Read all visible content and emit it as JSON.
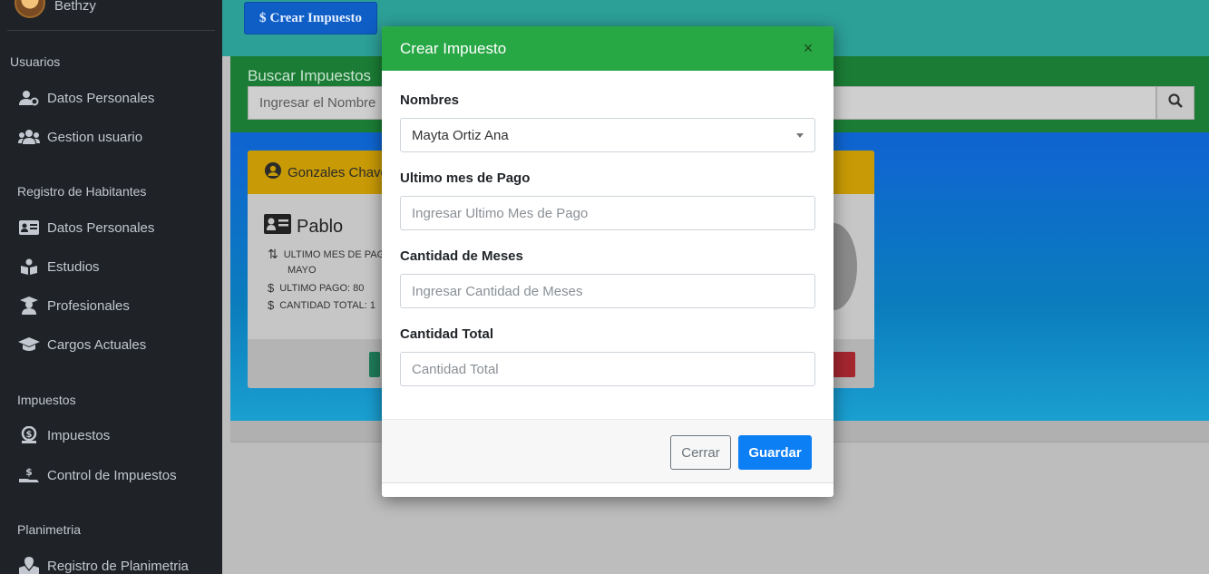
{
  "sidebar": {
    "user_name": "Bethzy",
    "sections": {
      "usuarios": "Usuarios",
      "registro": "Registro de Habitantes",
      "impuestos": "Impuestos",
      "planimetria": "Planimetria"
    },
    "items": [
      {
        "label": "Datos Personales",
        "icon": "user-cog-icon"
      },
      {
        "label": "Gestion usuario",
        "icon": "users-icon"
      },
      {
        "label": "Datos Personales",
        "icon": "id-card-icon"
      },
      {
        "label": "Estudios",
        "icon": "book-reader-icon"
      },
      {
        "label": "Profesionales",
        "icon": "user-graduate-icon"
      },
      {
        "label": "Cargos Actuales",
        "icon": "graduation-cap-icon"
      },
      {
        "label": "Impuestos",
        "icon": "coins-icon"
      },
      {
        "label": "Control de Impuestos",
        "icon": "hand-holding-usd-icon"
      },
      {
        "label": "Registro de Planimetria",
        "icon": "map-marked-icon"
      }
    ]
  },
  "toolbar": {
    "crear_label": "Crear Impuesto",
    "crear_icon": "dollar-icon"
  },
  "search": {
    "title": "Buscar Impuestos",
    "placeholder": "Ingresar el Nombre"
  },
  "card": {
    "header_name": "Gonzales Chave",
    "name": "Pablo",
    "ultimo_mes_label": "ULTIMO MES DE PAG",
    "ultimo_mes_value": "MAYO",
    "ultimo_pago": "ULTIMO PAGO: 80",
    "cantidad_total": "CANTIDAD TOTAL: 1"
  },
  "modal": {
    "title": "Crear Impuesto",
    "close_symbol": "×",
    "fields": {
      "nombres_label": "Nombres",
      "nombres_value": "Mayta Ortiz Ana",
      "ultimo_mes_label": "Ultimo mes de Pago",
      "ultimo_mes_placeholder": "Ingresar Ultimo Mes de Pago",
      "cantidad_meses_label": "Cantidad de Meses",
      "cantidad_meses_placeholder": "Ingresar Cantidad de Meses",
      "cantidad_total_label": "Cantidad Total",
      "cantidad_total_placeholder": "Cantidad Total"
    },
    "buttons": {
      "cerrar": "Cerrar",
      "guardar": "Guardar"
    }
  },
  "colors": {
    "modal_header": "#28a745",
    "primary": "#0d7ff5",
    "sidebar_bg": "#1f2226"
  }
}
